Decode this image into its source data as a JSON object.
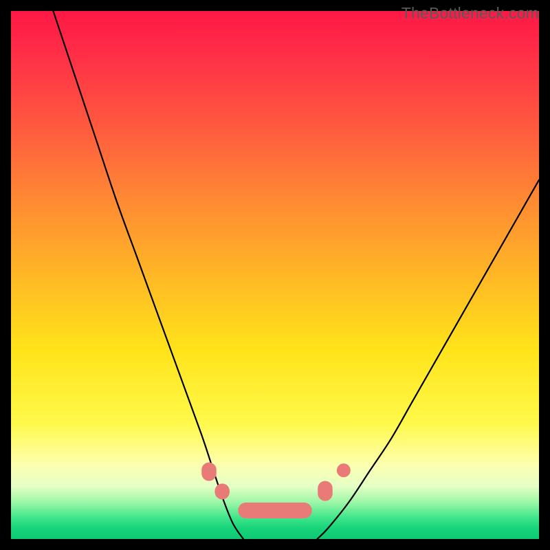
{
  "watermark": "TheBottleneck.com",
  "chart_data": {
    "type": "line",
    "title": "",
    "xlabel": "",
    "ylabel": "",
    "xlim": [
      0,
      100
    ],
    "ylim": [
      0,
      100
    ],
    "series": [
      {
        "name": "left-curve",
        "x": [
          8,
          12,
          16,
          20,
          24,
          28,
          32,
          36,
          38,
          40,
          42,
          44
        ],
        "y": [
          100,
          88,
          76,
          64,
          53,
          42,
          31,
          20,
          14,
          8,
          3,
          0
        ]
      },
      {
        "name": "right-curve",
        "x": [
          58,
          60,
          64,
          68,
          72,
          76,
          80,
          84,
          88,
          92,
          96,
          100
        ],
        "y": [
          0,
          2,
          7,
          13,
          19,
          26,
          33,
          40,
          47,
          54,
          61,
          68
        ]
      },
      {
        "name": "valley-flat",
        "x": [
          44,
          46,
          48,
          50,
          52,
          54,
          56,
          58
        ],
        "y": [
          0,
          0,
          0,
          0,
          0,
          0,
          0,
          0
        ]
      }
    ],
    "markers": [
      {
        "shape": "vcapsule",
        "cx": 37.5,
        "top": 85.5,
        "bottom": 89.0,
        "rx": 1.4
      },
      {
        "shape": "vcapsule",
        "cx": 40.0,
        "top": 89.5,
        "bottom": 92.5,
        "rx": 1.4
      },
      {
        "shape": "hcapsule",
        "cy": 94.6,
        "left": 43.0,
        "right": 57.0,
        "ry": 1.5
      },
      {
        "shape": "vcapsule",
        "cx": 59.5,
        "top": 89.0,
        "bottom": 92.8,
        "rx": 1.4
      },
      {
        "shape": "dot",
        "cx": 63.0,
        "cy": 87.0,
        "r": 1.3
      }
    ],
    "colors": {
      "curve": "#000000",
      "marker": "#e87a77"
    }
  }
}
